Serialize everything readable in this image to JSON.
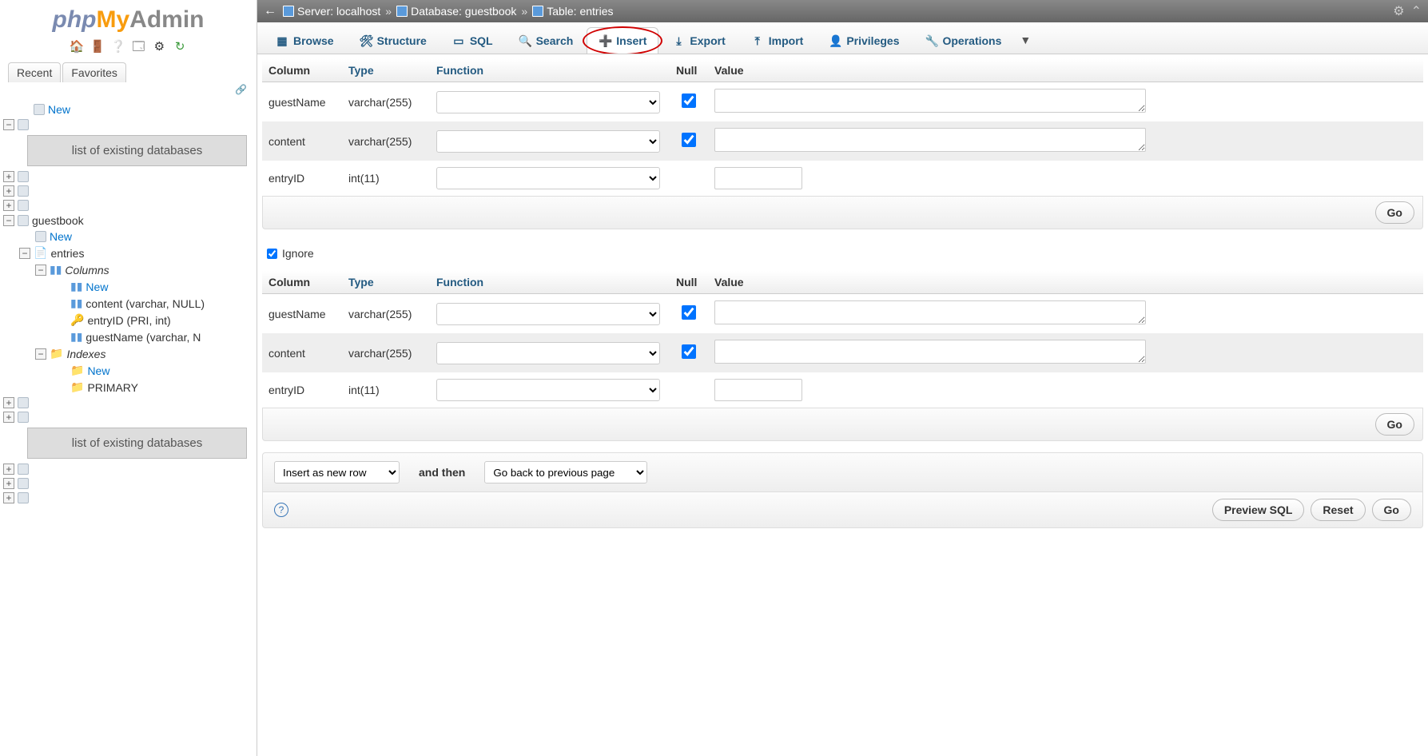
{
  "logo": {
    "php": "php",
    "my": "My",
    "admin": "Admin"
  },
  "sidebar": {
    "tabs": {
      "recent": "Recent",
      "favorites": "Favorites"
    },
    "new_label": "New",
    "dbgroup_label": "list of existing databases",
    "guestbook": {
      "name": "guestbook",
      "new": "New",
      "entries": {
        "name": "entries",
        "columns": {
          "label": "Columns",
          "new": "New",
          "items": [
            "content (varchar, NULL)",
            "entryID (PRI, int)",
            "guestName (varchar, N"
          ]
        },
        "indexes": {
          "label": "Indexes",
          "new": "New",
          "primary": "PRIMARY"
        }
      }
    }
  },
  "breadcrumb": {
    "server_label": "Server:",
    "server_value": "localhost",
    "database_label": "Database:",
    "database_value": "guestbook",
    "table_label": "Table:",
    "table_value": "entries"
  },
  "tabs": {
    "browse": "Browse",
    "structure": "Structure",
    "sql": "SQL",
    "search": "Search",
    "insert": "Insert",
    "export": "Export",
    "import": "Import",
    "privileges": "Privileges",
    "operations": "Operations"
  },
  "headers": {
    "column": "Column",
    "type": "Type",
    "function": "Function",
    "null": "Null",
    "value": "Value"
  },
  "rows1": [
    {
      "col": "guestName",
      "type": "varchar(255)",
      "null": true,
      "textarea": true
    },
    {
      "col": "content",
      "type": "varchar(255)",
      "null": true,
      "textarea": true
    },
    {
      "col": "entryID",
      "type": "int(11)",
      "null": false,
      "textarea": false
    }
  ],
  "rows2": [
    {
      "col": "guestName",
      "type": "varchar(255)",
      "null": true,
      "textarea": true
    },
    {
      "col": "content",
      "type": "varchar(255)",
      "null": true,
      "textarea": true
    },
    {
      "col": "entryID",
      "type": "int(11)",
      "null": false,
      "textarea": false
    }
  ],
  "ignore_label": "Ignore",
  "go_label": "Go",
  "bottom": {
    "insert_as": "Insert as new row",
    "and_then": "and then",
    "go_back": "Go back to previous page",
    "preview": "Preview SQL",
    "reset": "Reset",
    "go": "Go"
  }
}
